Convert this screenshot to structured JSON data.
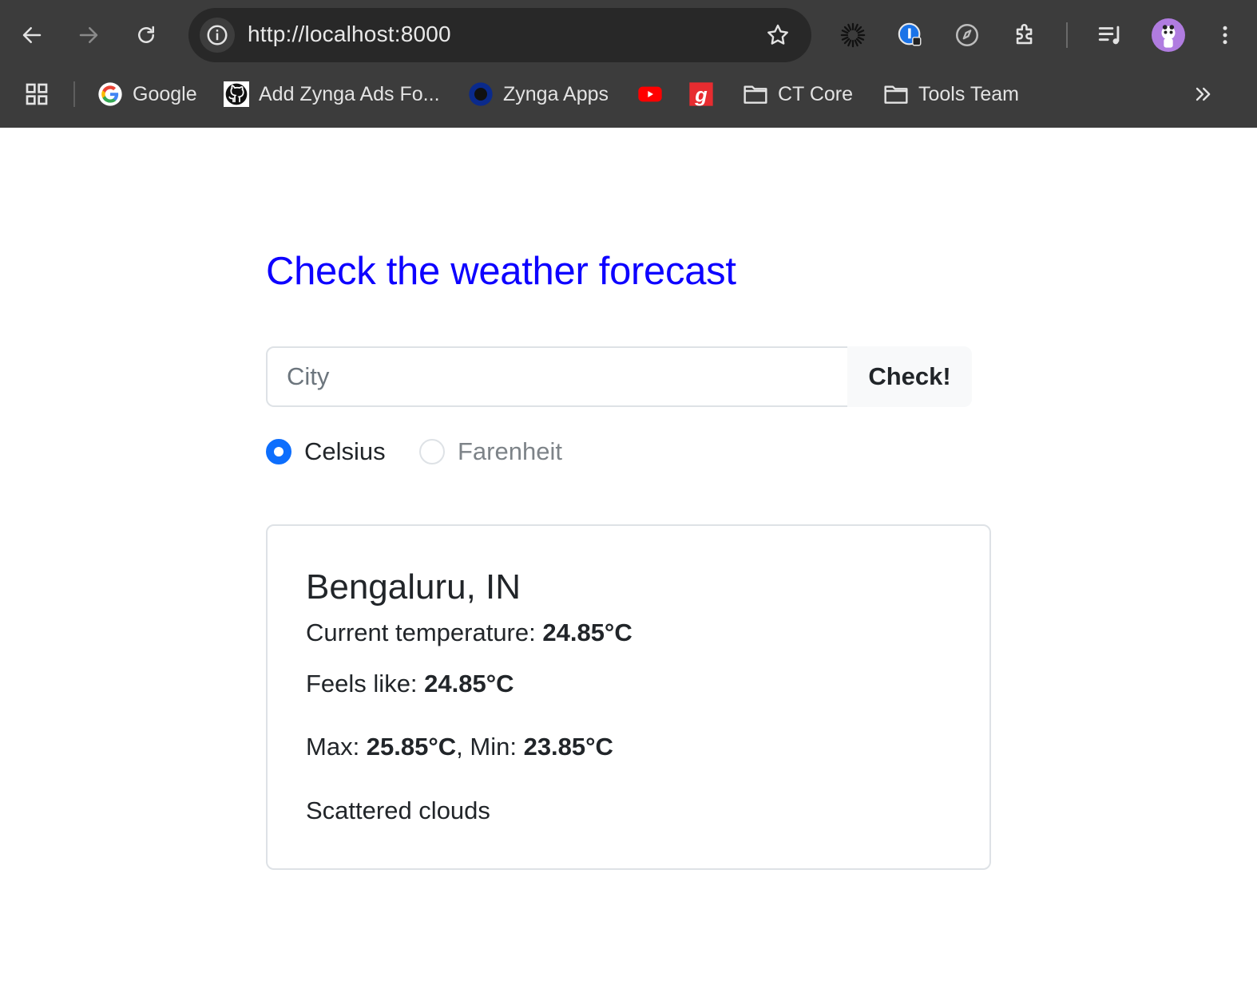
{
  "browser": {
    "url": "http://localhost:8000",
    "bookmarks": [
      {
        "label": "Google",
        "icon": "google-icon"
      },
      {
        "label": "Add Zynga Ads Fo...",
        "icon": "github-icon"
      },
      {
        "label": "Zynga Apps",
        "icon": "zynga-icon"
      },
      {
        "label": "",
        "icon": "youtube-icon"
      },
      {
        "label": "",
        "icon": "gaana-icon"
      },
      {
        "label": "CT Core",
        "icon": "folder-icon"
      },
      {
        "label": "Tools Team",
        "icon": "folder-icon"
      }
    ],
    "more_bookmarks_icon": "double-chevron-icon"
  },
  "page": {
    "title": "Check the weather forecast",
    "search": {
      "placeholder": "City",
      "value": "",
      "button_label": "Check!"
    },
    "units": [
      {
        "label": "Celsius",
        "selected": true
      },
      {
        "label": "Farenheit",
        "selected": false
      }
    ]
  },
  "result": {
    "location": "Bengaluru, IN",
    "current_label": "Current temperature: ",
    "current_value": "24.85°C",
    "feels_label": "Feels like: ",
    "feels_value": "24.85°C",
    "max_label": "Max: ",
    "max_value": "25.85°C",
    "min_label": ", Min: ",
    "min_value": "23.85°C",
    "description": "Scattered clouds"
  },
  "colors": {
    "accent": "#0d00ff",
    "radio_selected": "#0d6efd",
    "chrome_bg": "#3c3c3c"
  }
}
